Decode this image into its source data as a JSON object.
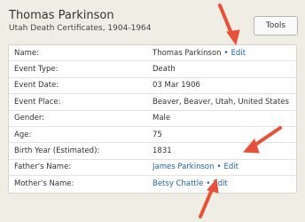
{
  "record": {
    "name": "Thomas Parkinson",
    "collection": "Utah Death Certificates, 1904-1964",
    "tools_label": "Tools"
  },
  "rows": [
    {
      "label": "Name:",
      "value": "Thomas Parkinson",
      "value_is_link": false,
      "edit": "Edit"
    },
    {
      "label": "Event Type:",
      "value": "Death"
    },
    {
      "label": "Event Date:",
      "value": "03 Mar 1906"
    },
    {
      "label": "Event Place:",
      "value": "Beaver, Beaver, Utah, United States"
    },
    {
      "label": "Gender:",
      "value": "Male"
    },
    {
      "label": "Age:",
      "value": "75"
    },
    {
      "label": "Birth Year (Estimated):",
      "value": "1831"
    },
    {
      "label": "Father's Name:",
      "value": "James Parkinson",
      "value_is_link": true,
      "edit": "Edit"
    },
    {
      "label": "Mother's Name:",
      "value": "Betsy Chattle",
      "value_is_link": true,
      "edit": "Edit"
    }
  ],
  "separator": "•",
  "colors": {
    "background": "#f0ede5",
    "link": "#1a64a7",
    "arrow": "#e8503a"
  }
}
